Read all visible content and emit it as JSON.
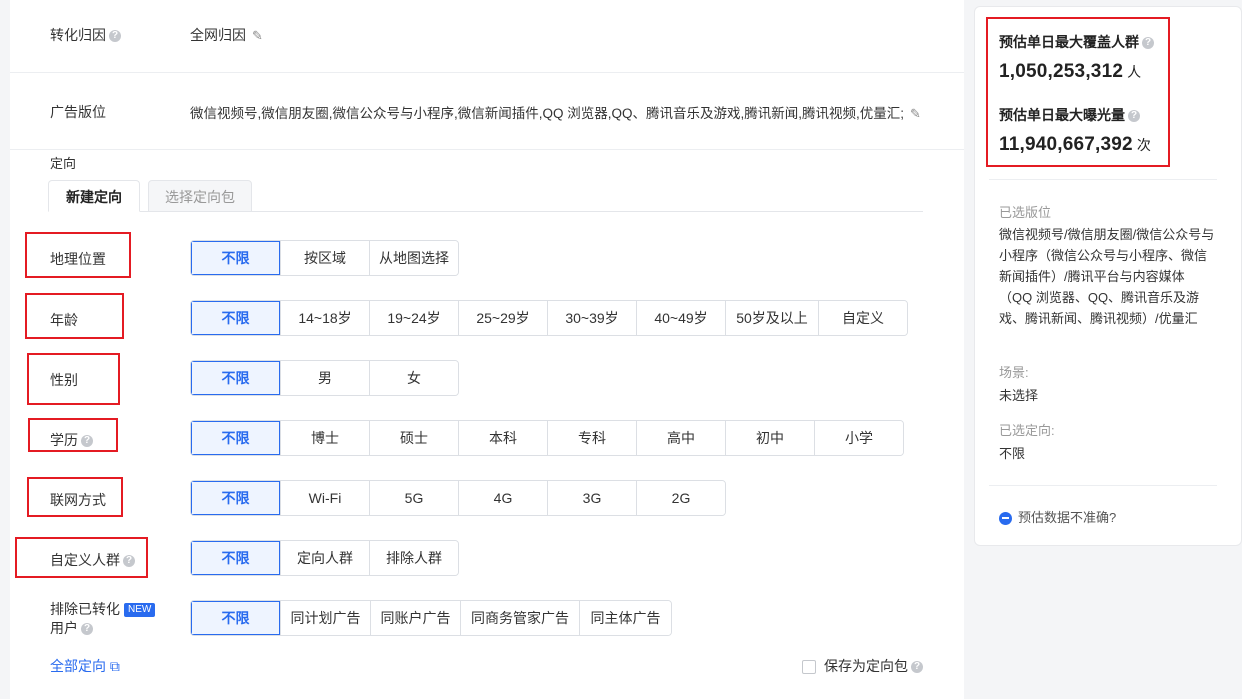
{
  "attribution": {
    "label": "转化归因",
    "value": "全网归因"
  },
  "placement": {
    "label": "广告版位",
    "value": "微信视频号,微信朋友圈,微信公众号与小程序,微信新闻插件,QQ 浏览器,QQ、腾讯音乐及游戏,腾讯新闻,腾讯视频,优量汇;"
  },
  "targeting": {
    "label": "定向",
    "tabs": [
      "新建定向",
      "选择定向包"
    ],
    "rows": {
      "geo": {
        "label": "地理位置",
        "options": [
          "不限",
          "按区域",
          "从地图选择"
        ]
      },
      "age": {
        "label": "年龄",
        "options": [
          "不限",
          "14~18岁",
          "19~24岁",
          "25~29岁",
          "30~39岁",
          "40~49岁",
          "50岁及以上",
          "自定义"
        ]
      },
      "gender": {
        "label": "性别",
        "options": [
          "不限",
          "男",
          "女"
        ]
      },
      "education": {
        "label": "学历",
        "options": [
          "不限",
          "博士",
          "硕士",
          "本科",
          "专科",
          "高中",
          "初中",
          "小学"
        ]
      },
      "network": {
        "label": "联网方式",
        "options": [
          "不限",
          "Wi-Fi",
          "5G",
          "4G",
          "3G",
          "2G"
        ]
      },
      "custom_audience": {
        "label": "自定义人群",
        "options": [
          "不限",
          "定向人群",
          "排除人群"
        ]
      },
      "exclude_converted": {
        "label_line1": "排除已转化",
        "label_line2": "用户",
        "badge": "NEW",
        "options": [
          "不限",
          "同计划广告",
          "同账户广告",
          "同商务管家广告",
          "同主体广告"
        ]
      }
    },
    "all_link": "全部定向",
    "save_label": "保存为定向包"
  },
  "sidebar": {
    "reach_title": "预估单日最大覆盖人群",
    "reach_value": "1,050,253,312",
    "reach_unit": "人",
    "exposure_title": "预估单日最大曝光量",
    "exposure_value": "11,940,667,392",
    "exposure_unit": "次",
    "placement_label": "已选版位",
    "placement_text": "微信视频号/微信朋友圈/微信公众号与小程序（微信公众号与小程序、微信新闻插件）/腾讯平台与内容媒体（QQ 浏览器、QQ、腾讯音乐及游戏、腾讯新闻、腾讯视频）/优量汇",
    "scene_label": "场景:",
    "scene_value": "未选择",
    "targeting_label": "已选定向:",
    "targeting_value": "不限",
    "feedback": "预估数据不准确?"
  },
  "colors": {
    "accent": "#296bef",
    "highlight": "#e41b23"
  }
}
